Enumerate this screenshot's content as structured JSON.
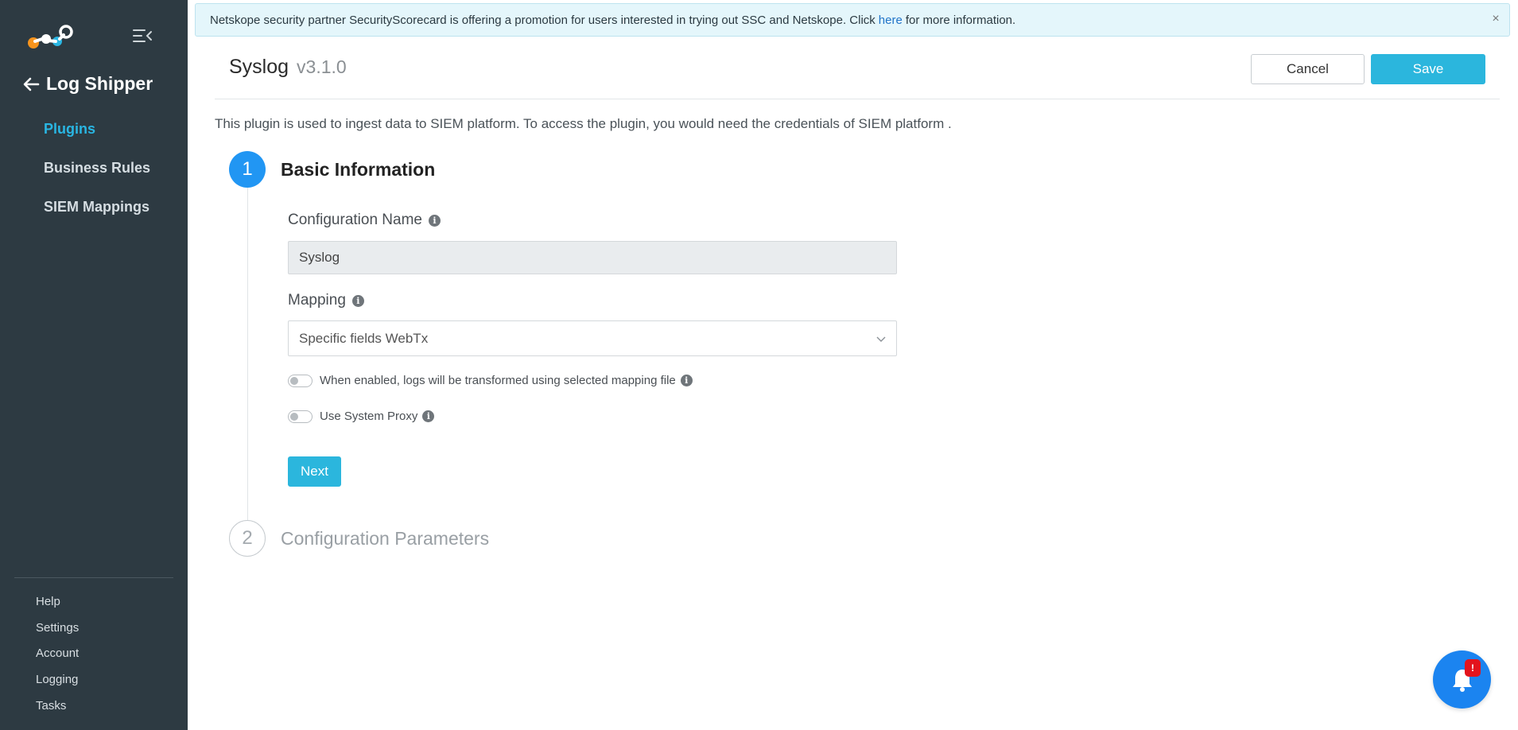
{
  "sidebar": {
    "section_title": "Log Shipper",
    "nav": [
      {
        "label": "Plugins",
        "active": true
      },
      {
        "label": "Business Rules",
        "active": false
      },
      {
        "label": "SIEM Mappings",
        "active": false
      }
    ],
    "footer": [
      {
        "label": "Help"
      },
      {
        "label": "Settings"
      },
      {
        "label": "Account"
      },
      {
        "label": "Logging"
      },
      {
        "label": "Tasks"
      }
    ]
  },
  "banner": {
    "text_before": "Netskope security partner SecurityScorecard is offering a promotion for users interested in trying out SSC and Netskope. Click",
    "link": "here",
    "text_after": "for more information.",
    "close": "×"
  },
  "header": {
    "title": "Syslog",
    "version": "v3.1.0",
    "cancel_label": "Cancel",
    "save_label": "Save"
  },
  "description": "This plugin is used to ingest data to SIEM platform. To access the plugin, you would need the credentials of SIEM platform .",
  "steps": [
    {
      "number": "1",
      "title": "Basic Information"
    },
    {
      "number": "2",
      "title": "Configuration Parameters"
    }
  ],
  "form": {
    "config_name_label": "Configuration Name",
    "config_name_value": "Syslog",
    "mapping_label": "Mapping",
    "mapping_value": "Specific fields WebTx",
    "toggle_transform_label": "When enabled, logs will be transformed using selected mapping file",
    "toggle_proxy_label": "Use System Proxy",
    "next_label": "Next",
    "info_glyph": "i"
  },
  "notification": {
    "badge": "!"
  },
  "colors": {
    "sidebar_bg": "#2d3a42",
    "accent": "#2bb6dd",
    "step_active": "#2196f3",
    "badge": "#e3141d"
  }
}
